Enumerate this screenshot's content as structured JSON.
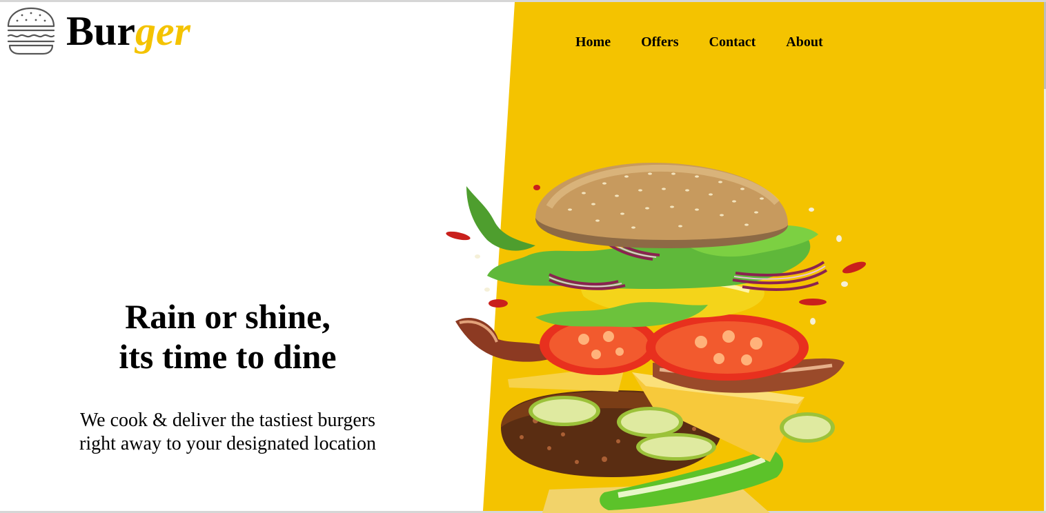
{
  "brand": {
    "name_main": "Bur",
    "name_accent": "ger",
    "logo_icon": "burger-icon",
    "accent_color": "#f4c300"
  },
  "nav": {
    "items": [
      {
        "label": "Home"
      },
      {
        "label": "Offers"
      },
      {
        "label": "Contact"
      },
      {
        "label": "About"
      }
    ]
  },
  "hero": {
    "title_line1": "Rain or shine,",
    "title_line2": "its time to dine",
    "subtitle_line1": "We cook & deliver the tastiest burgers",
    "subtitle_line2": "right away to your designated location",
    "image": "burger-image"
  },
  "colors": {
    "background": "#ffffff",
    "panel": "#f4c300",
    "text": "#000000"
  }
}
